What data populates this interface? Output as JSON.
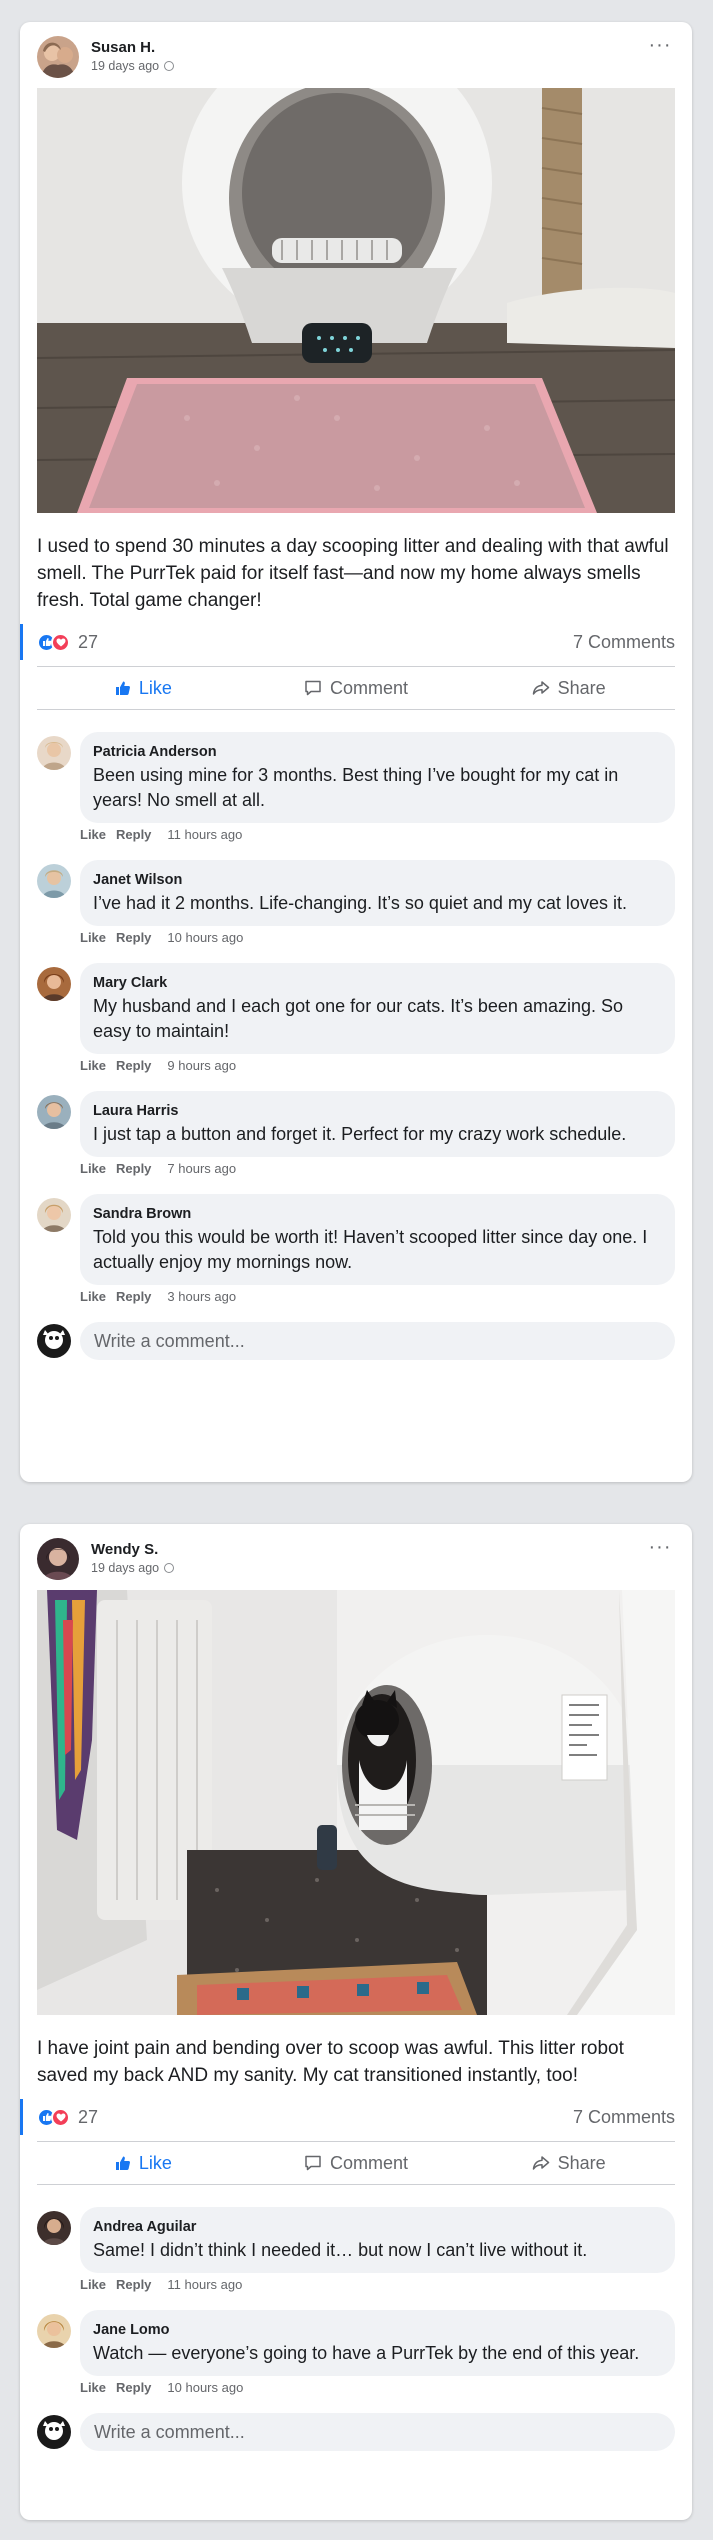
{
  "posts": [
    {
      "author": "Susan H.",
      "time": "19 days ago",
      "caption": "I used to spend 30 minutes a day scooping litter and dealing with that awful smell. The PurrTek paid for itself fast—and now my home always smells fresh. Total game changer!",
      "reaction_count": "27",
      "comments_count": "7 Comments",
      "actions": {
        "like": "Like",
        "comment": "Comment",
        "share": "Share"
      },
      "comments": [
        {
          "name": "Patricia Anderson",
          "text": "Been using mine for 3 months. Best thing I’ve bought for my cat in years! No smell at all.",
          "like": "Like",
          "reply": "Reply",
          "time": "11 hours ago"
        },
        {
          "name": "Janet Wilson",
          "text": "I’ve had it 2 months. Life-changing. It’s so quiet and my cat loves it.",
          "like": "Like",
          "reply": "Reply",
          "time": "10 hours ago"
        },
        {
          "name": "Mary Clark",
          "text": "My husband and I each got one for our cats. It’s been amazing. So easy to maintain!",
          "like": "Like",
          "reply": "Reply",
          "time": "9 hours ago"
        },
        {
          "name": "Laura Harris",
          "text": "I just tap a button and forget it. Perfect for my crazy work schedule.",
          "like": "Like",
          "reply": "Reply",
          "time": "7 hours ago"
        },
        {
          "name": "Sandra Brown",
          "text": "Told you this would be worth it! Haven’t scooped litter since day one. I actually enjoy my mornings now.",
          "like": "Like",
          "reply": "Reply",
          "time": "3 hours ago"
        }
      ],
      "write_placeholder": "Write a comment..."
    },
    {
      "author": "Wendy S.",
      "time": "19 days ago",
      "caption": "I have joint pain and bending over to scoop was awful. This litter robot saved my back AND my sanity. My cat transitioned instantly, too!",
      "reaction_count": "27",
      "comments_count": "7 Comments",
      "actions": {
        "like": "Like",
        "comment": "Comment",
        "share": "Share"
      },
      "comments": [
        {
          "name": "Andrea Aguilar",
          "text": "Same! I didn’t think I needed it… but now I can’t live without it.",
          "like": "Like",
          "reply": "Reply",
          "time": "11 hours ago"
        },
        {
          "name": "Jane Lomo",
          "text": "Watch — everyone’s going to have a PurrTek by the end of this year.",
          "like": "Like",
          "reply": "Reply",
          "time": "10 hours ago"
        }
      ],
      "write_placeholder": "Write a comment..."
    }
  ],
  "colors": {
    "accent": "#1877f2",
    "love": "#f33e58",
    "bubble": "#f0f2f5",
    "page_bg": "#e4e6e9"
  }
}
